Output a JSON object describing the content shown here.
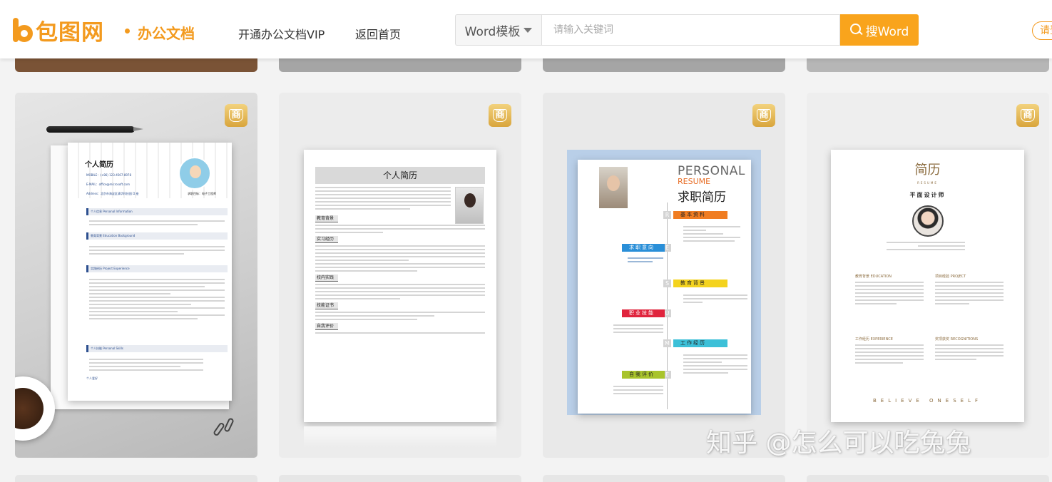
{
  "header": {
    "logo_text": "包图网",
    "section": "办公文档",
    "nav": {
      "vip": "开通办公文档VIP",
      "home": "返回首页"
    },
    "search": {
      "type": "Word模板",
      "placeholder": "请输入关键词",
      "button": "搜Word"
    },
    "login": "请登"
  },
  "cards": [
    {
      "badge": "商",
      "title": "个人简历",
      "mobile": "MOBILE：(+86) 123-4567-8978",
      "email": "E-MAIL：office@microsoft.com",
      "address": "Address：北京市海淀区清华科技园 D 座",
      "goal": "求职目标：电子工程师",
      "sections": [
        "个人信息 Personal Information",
        "教育背景 Education Background",
        "实践经历 Project Experience",
        "个人技能 Personal Skills",
        "个人爱好"
      ]
    },
    {
      "badge": "商",
      "title": "个人简历",
      "sections": [
        "教育背景",
        "实习经历",
        "校内实践",
        "技能证书",
        "自我评价"
      ]
    },
    {
      "badge": "商",
      "personal": "PERSONAL",
      "resume": "RESUME",
      "title": "求职简历",
      "tags": [
        "基本资料",
        "求职意向",
        "教育背景",
        "职业技能",
        "工作经历",
        "自我评价"
      ],
      "letters": [
        "R",
        "E",
        "S",
        "U",
        "M",
        "E"
      ]
    },
    {
      "badge": "商",
      "logo": "简历",
      "resume": "RESUME",
      "name": "平面设计师",
      "sections": [
        "教育背景 EDUCATION",
        "项目经验 PROJECT",
        "工作经历 EXPERIENCE",
        "奖项获奖 RECOGNITIONS"
      ],
      "motto": "BELIEVE ONESELF"
    }
  ],
  "watermark": "知乎 @怎么可以吃兔兔"
}
